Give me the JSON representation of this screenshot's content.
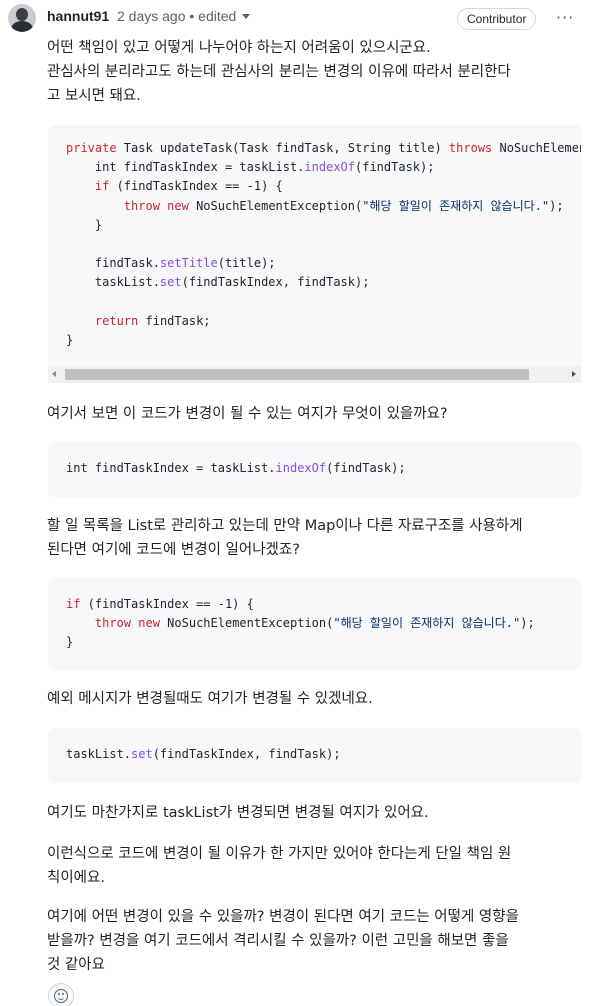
{
  "comment": {
    "author": "hannut91",
    "meta": "2 days ago • edited",
    "badge": "Contributor",
    "menu_glyph": "···"
  },
  "paragraphs": {
    "p1_l1": "어떤 책임이 있고 어떻게 나누어야 하는지 어려움이 있으시군요.",
    "p1_l2": "관심사의 분리라고도 하는데 관심사의 분리는 변경의 이유에 따라서 분리한다",
    "p1_l3": "고 보시면 돼요.",
    "p2": "여기서 보면 이 코드가 변경이 될 수 있는 여지가 무엇이 있을까요?",
    "p3_l1": "할 일 목록을 List로 관리하고 있는데 만약 Map이나 다른 자료구조를 사용하게",
    "p3_l2": "된다면 여기에 코드에 변경이 일어나겠죠?",
    "p4": "예외 메시지가 변경될때도 여기가 변경될 수 있겠네요.",
    "p5": "여기도 마찬가지로 taskList가 변경되면 변경될 여지가 있어요.",
    "p6_l1": "이런식으로 코드에 변경이 될 이유가 한 가지만 있어야 한다는게 단일 책임 원",
    "p6_l2": "칙이에요.",
    "p7_l1": "여기에 어떤 변경이 있을 수 있을까? 변경이 된다면 여기 코드는 어떻게 영향을",
    "p7_l2": "받을까? 변경을 여기 코드에서 격리시킬 수 있을까? 이런 고민을 해보면 좋을",
    "p7_l3": "것 같아요"
  },
  "code1": {
    "l1_kw": "private",
    "l1_a": " Task updateTask(Task findTask, String title) ",
    "l1_kw2": "throws",
    "l1_b": " NoSuchElementException {",
    "l2_a": "    int findTaskIndex = taskList.",
    "l2_fn": "indexOf",
    "l2_b": "(findTask);",
    "l3_kw": "if",
    "l3_b": " (findTaskIndex == -1) {",
    "l4_kw": "throw",
    "l4_kw2": "new",
    "l4_a": " NoSuchElementException(",
    "l4_str": "\"해당 할일이 존재하지 않습니다.\"",
    "l4_b": ");",
    "l5": "    }",
    "l7_a": "    findTask.",
    "l7_fn": "setTitle",
    "l7_b": "(title);",
    "l8_a": "    taskList.",
    "l8_fn": "set",
    "l8_b": "(findTaskIndex, findTask);",
    "l10_kw": "return",
    "l10_b": " findTask;",
    "l11": "}"
  },
  "code2": {
    "a": "int findTaskIndex = taskList.",
    "fn": "indexOf",
    "b": "(findTask);"
  },
  "code3": {
    "l1_kw": "if",
    "l1_b": " (findTaskIndex == -1) {",
    "l2_kw": "throw",
    "l2_kw2": "new",
    "l2_a": " NoSuchElementException(",
    "l2_str": "\"해당 할일이 존재하지 않습니다.\"",
    "l2_b": ");",
    "l3": "}"
  },
  "code4": {
    "a": "taskList.",
    "fn": "set",
    "b": "(findTaskIndex, findTask);"
  },
  "colors": {
    "keyword": "#cf222e",
    "function": "#8250df",
    "string": "#0a3069",
    "code_bg": "#f6f8fa"
  },
  "icons": {
    "avatar": "avatar",
    "meta_caret": "chevron-down-icon",
    "kebab": "kebab-menu-icon",
    "emoji": "smiley-icon"
  }
}
